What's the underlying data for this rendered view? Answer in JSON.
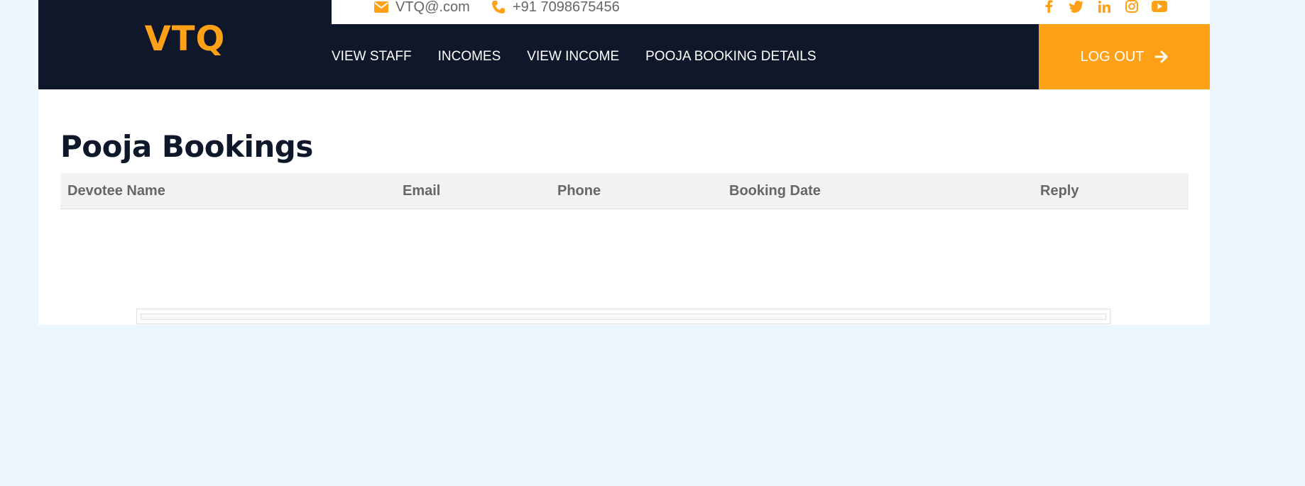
{
  "brand": {
    "logo": "VTQ"
  },
  "topbar": {
    "email": "VTQ@.com",
    "phone": "+91 7098675456",
    "socials": [
      "facebook-icon",
      "twitter-icon",
      "linkedin-icon",
      "instagram-icon",
      "youtube-icon"
    ]
  },
  "nav": {
    "items": [
      {
        "label": "VIEW STAFF"
      },
      {
        "label": "INCOMES"
      },
      {
        "label": "VIEW INCOME"
      },
      {
        "label": "POOJA BOOKING DETAILS"
      }
    ],
    "logout": "LOG OUT"
  },
  "main": {
    "title": "Pooja Bookings",
    "columns": [
      "Devotee Name",
      "Email",
      "Phone",
      "Booking Date",
      "Reply"
    ]
  },
  "colors": {
    "accent": "#fea116",
    "dark": "#0f172a",
    "background": "#eef6fd"
  }
}
